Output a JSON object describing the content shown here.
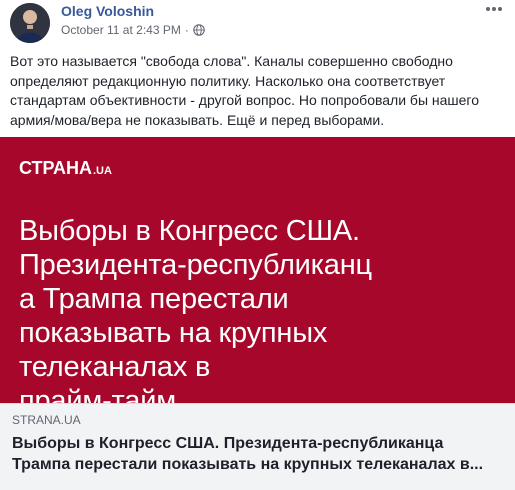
{
  "post": {
    "author": "Oleg Voloshin",
    "timestamp": "October 11 at 2:43 PM",
    "separator": "·",
    "privacy_icon": "globe-icon",
    "more_icon": "more-options-icon",
    "text": "Вот это называется \"свобода слова\". Каналы совершенно свободно определяют редакционную политику. Насколько она соответствует стандартам объективности - другой вопрос. Но попробовали бы нашего армия/мова/вера не показывать. Ещё и перед выборами."
  },
  "link_preview": {
    "image": {
      "background_color": "#a6072a",
      "logo_text": "СТРАНА",
      "logo_suffix": ".UA",
      "headline_lines": [
        "Выборы в Конгресс США.",
        "Президента-республиканц",
        "а Трампа перестали",
        "показывать на крупных",
        "телеканалах в",
        "прайм-тайм"
      ]
    },
    "domain": "STRANA.UA",
    "title_lines": [
      "Выборы в Конгресс США. Президента-республиканца",
      "Трампа перестали показывать на крупных телеканалах в..."
    ]
  },
  "colors": {
    "author_link": "#385898",
    "preview_red": "#a6072a",
    "caption_bg": "#f2f3f5"
  }
}
